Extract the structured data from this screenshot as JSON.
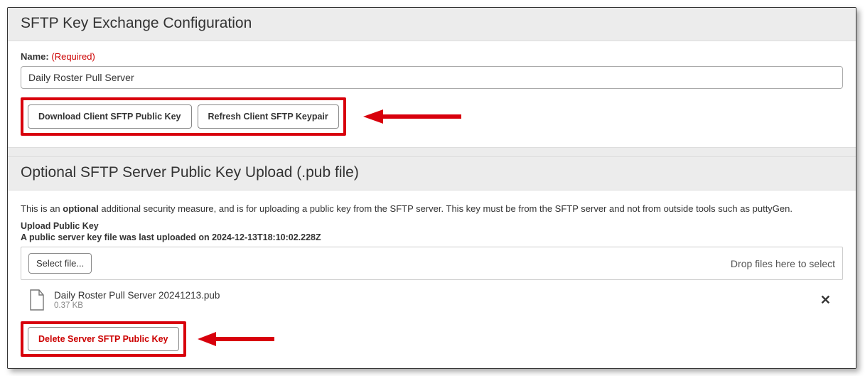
{
  "section1": {
    "title": "SFTP Key Exchange Configuration",
    "name_label": "Name:",
    "required_text": "(Required)",
    "name_value": "Daily Roster Pull Server",
    "download_btn": "Download Client SFTP Public Key",
    "refresh_btn": "Refresh Client SFTP Keypair"
  },
  "section2": {
    "title": "Optional SFTP Server Public Key Upload (.pub file)",
    "desc_pre": "This is an ",
    "desc_bold": "optional",
    "desc_post": " additional security measure, and is for uploading a public key from the SFTP server. This key must be from the SFTP server and not from outside tools such as puttyGen.",
    "upload_label": "Upload Public Key",
    "status_line": "A public server key file was last uploaded on 2024-12-13T18:10:02.228Z",
    "select_file": "Select file...",
    "drop_hint": "Drop files here to select",
    "file_name": "Daily Roster Pull Server 20241213.pub",
    "file_size": "0.37 KB",
    "delete_btn": "Delete Server SFTP Public Key"
  }
}
